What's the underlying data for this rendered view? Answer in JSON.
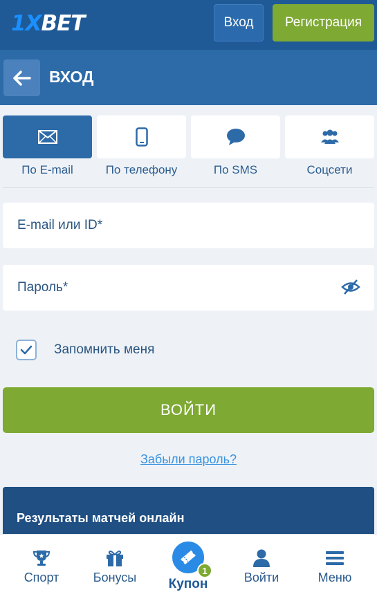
{
  "header": {
    "logo_prefix": "1X",
    "logo_suffix": "BET",
    "login_label": "Вход",
    "register_label": "Регистрация"
  },
  "page": {
    "title": "ВХОД"
  },
  "methods": [
    {
      "label": "По E-mail",
      "icon": "envelope-icon",
      "active": true
    },
    {
      "label": "По телефону",
      "icon": "phone-icon",
      "active": false
    },
    {
      "label": "По SMS",
      "icon": "chat-bubble-icon",
      "active": false
    },
    {
      "label": "Соцсети",
      "icon": "users-icon",
      "active": false
    }
  ],
  "form": {
    "email_placeholder": "E-mail или ID*",
    "password_placeholder": "Пароль*",
    "remember_label": "Запомнить меня",
    "remember_checked": true,
    "submit_label": "ВОЙТИ",
    "forgot_label": "Забыли пароль?"
  },
  "results": {
    "title": "Результаты матчей онлайн"
  },
  "nav": {
    "sport": "Спорт",
    "bonuses": "Бонусы",
    "coupon": "Купон",
    "coupon_count": "1",
    "login": "Войти",
    "menu": "Меню"
  },
  "colors": {
    "primary": "#1f5a96",
    "accent_green": "#7ea932",
    "link_blue": "#3a93e0"
  }
}
